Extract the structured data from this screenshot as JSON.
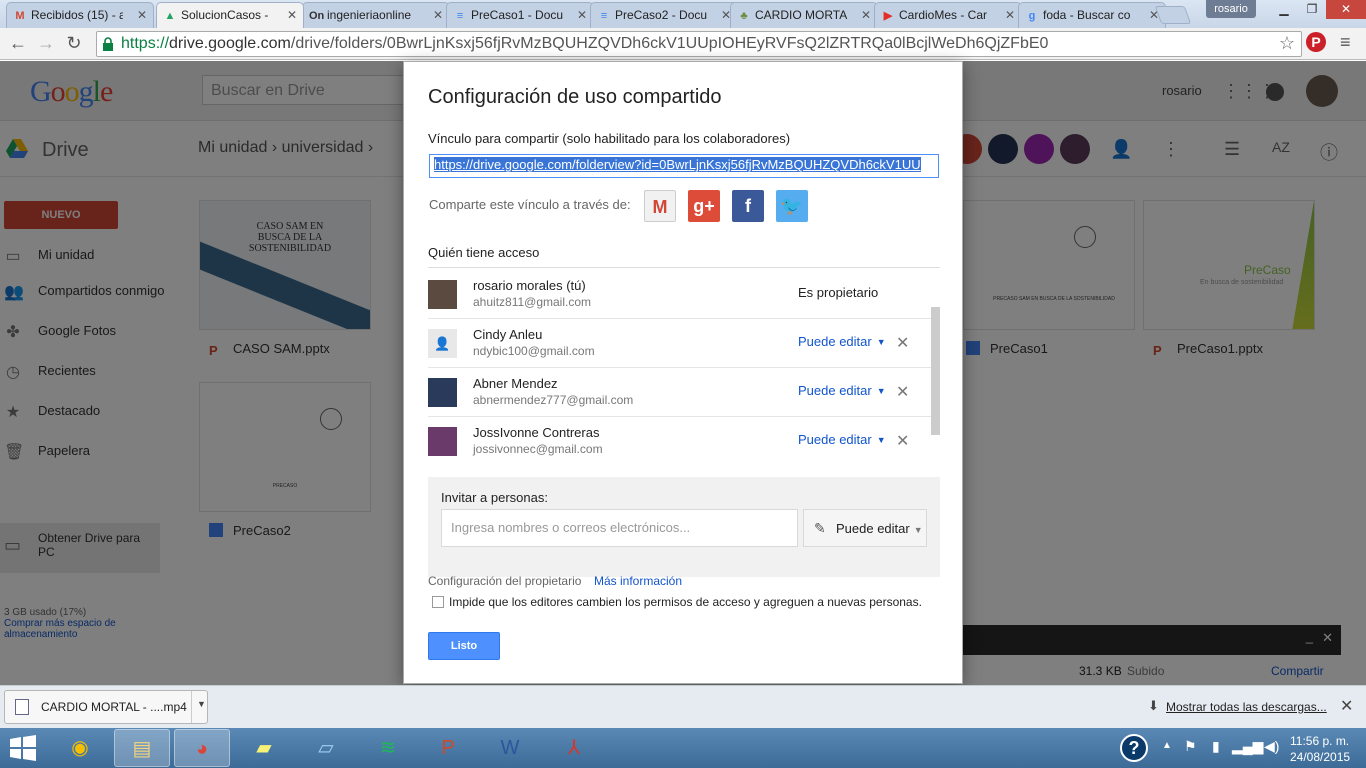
{
  "browser": {
    "tabs": [
      {
        "label": "Recibidos (15) - a",
        "icon": "gmail-icon",
        "color": "#d14836",
        "glyph": "M"
      },
      {
        "label": "SolucionCasos - ",
        "icon": "drive-icon",
        "color": "#1fa463",
        "glyph": "▲"
      },
      {
        "label": "ingenieriaonline",
        "icon": "site-icon",
        "color": "#333333",
        "glyph": "On"
      },
      {
        "label": "PreCaso1 - Docu",
        "icon": "docs-icon",
        "color": "#4285f4",
        "glyph": "≡"
      },
      {
        "label": "PreCaso2 - Docu",
        "icon": "docs-icon",
        "color": "#4285f4",
        "glyph": "≡"
      },
      {
        "label": "CARDIO MORTA",
        "icon": "site-icon",
        "color": "#6a8e3e",
        "glyph": "♣"
      },
      {
        "label": "CardioMes - Car",
        "icon": "youtube-icon",
        "color": "#e52d27",
        "glyph": "▶"
      },
      {
        "label": "foda - Buscar co",
        "icon": "google-icon",
        "color": "#4285f4",
        "glyph": "g"
      }
    ],
    "user": "rosario",
    "url_prefix": "https://",
    "url_host": "drive.google.com",
    "url_path": "/drive/folders/0BwrLjnKsxj56fjRvMzBQUHZQVDh6ckV1UUpIOHEyRVFsQ2lZRTRQa0lBcjlWeDh6QjZFbE0"
  },
  "drive": {
    "logo": "Google",
    "search_placeholder": "Buscar en Drive",
    "user": "rosario",
    "app_name": "Drive",
    "breadcrumb": "Mi unidad  ›  universidad  ›",
    "new_button": "NUEVO",
    "nav": [
      {
        "label": "Mi unidad",
        "icon": "drive-folder-icon",
        "glyph": "▭"
      },
      {
        "label": "Compartidos conmigo",
        "icon": "people-icon",
        "glyph": "👥"
      },
      {
        "label": "Google Fotos",
        "icon": "photos-icon",
        "glyph": "✤"
      },
      {
        "label": "Recientes",
        "icon": "clock-icon",
        "glyph": "◷"
      },
      {
        "label": "Destacado",
        "icon": "star-icon",
        "glyph": "★"
      },
      {
        "label": "Papelera",
        "icon": "trash-icon",
        "glyph": "🗑"
      }
    ],
    "get_drive": "Obtener Drive para PC",
    "quota_used": "3 GB usado (17%)",
    "quota_link": "Comprar más espacio de almacenamiento",
    "files": [
      {
        "name": "CASO SAM.pptx",
        "thumb_title": "CASO SAM EN BUSCA DE LA SOSTENIBILIDAD",
        "type": "pptx"
      },
      {
        "name": "PreCaso1",
        "thumb_title": "PRECASO SAM EN BUSCA DE LA SOSTENIBILIDAD",
        "type": "doc"
      },
      {
        "name": "PreCaso1.pptx",
        "thumb_title": "PreCaso",
        "thumb_sub": "En busca de sostenibilidad",
        "type": "pptx"
      },
      {
        "name": "PreCaso2",
        "thumb_title": "PRECASO",
        "type": "doc"
      }
    ],
    "upload_size": "31.3 KB",
    "upload_status": "Subido",
    "upload_action": "Compartir"
  },
  "dialog": {
    "title": "Configuración de uso compartido",
    "link_label": "Vínculo para compartir (solo habilitado para los colaboradores)",
    "link_value": "https://drive.google.com/folderview?id=0BwrLjnKsxj56fjRvMzBQUHZQVDh6ckV1UU",
    "share_via_label": "Comparte este vínculo a través de:",
    "access_heading": "Quién tiene acceso",
    "people": [
      {
        "name": "rosario morales (tú)",
        "email": "ahuitz811@gmail.com",
        "role": "Es propietario",
        "removable": false,
        "avatar_color": "#5b4a40"
      },
      {
        "name": "Cindy Anleu",
        "email": "ndybic100@gmail.com",
        "role": "Puede editar",
        "removable": true,
        "avatar_color": "#e8e8e8"
      },
      {
        "name": "Abner Mendez",
        "email": "abnermendez777@gmail.com",
        "role": "Puede editar",
        "removable": true,
        "avatar_color": "#2a3a5a"
      },
      {
        "name": "JossIvonne Contreras",
        "email": "jossivonnec@gmail.com",
        "role": "Puede editar",
        "removable": true,
        "avatar_color": "#6a3b6a"
      }
    ],
    "invite_label": "Invitar a personas:",
    "invite_placeholder": "Ingresa nombres o correos electrónicos...",
    "invite_permission": "Puede editar",
    "owner_settings_label": "Configuración del propietario",
    "more_info_link": "Más información",
    "prevent_label": "Impide que los editores cambien los permisos de acceso y agreguen a nuevas personas.",
    "done_button": "Listo"
  },
  "shelf": {
    "download_name": "CARDIO MORTAL - ....mp4",
    "show_all": "Mostrar todas las descargas..."
  },
  "taskbar": {
    "apps": [
      {
        "name": "media-player-icon",
        "glyph": "◉",
        "color": "#f5c000"
      },
      {
        "name": "file-explorer-icon",
        "glyph": "▤",
        "color": "#f4d47c"
      },
      {
        "name": "chrome-icon",
        "glyph": "◕",
        "color": "#db4437"
      },
      {
        "name": "sticky-notes-icon",
        "glyph": "▰",
        "color": "#f8f178"
      },
      {
        "name": "notepad-icon",
        "glyph": "▱",
        "color": "#9fd0f0"
      },
      {
        "name": "spotify-icon",
        "glyph": "≋",
        "color": "#1db954"
      },
      {
        "name": "powerpoint-icon",
        "glyph": "P",
        "color": "#d24726"
      },
      {
        "name": "word-icon",
        "glyph": "W",
        "color": "#2b579a"
      },
      {
        "name": "acrobat-icon",
        "glyph": "⅄",
        "color": "#d9352a"
      }
    ],
    "time": "11:56 p. m.",
    "date": "24/08/2015"
  }
}
